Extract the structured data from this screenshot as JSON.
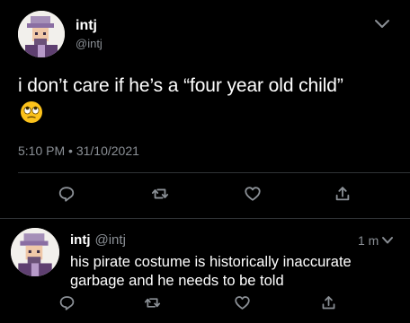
{
  "tweet": {
    "display_name": "intj",
    "handle": "@intj",
    "text": "i don’t care if he’s a “four year old child”",
    "emoji": "face-with-rolling-eyes",
    "timestamp": "5:10 PM • 31/10/2021"
  },
  "reply": {
    "display_name": "intj",
    "handle": "@intj",
    "time": "1 m",
    "text": "his pirate costume is historically inaccurate garbage and he needs to be told"
  },
  "icons": {
    "menu": "chevron-down-icon",
    "reply": "reply-icon",
    "retweet": "retweet-icon",
    "like": "heart-icon",
    "share": "share-icon"
  },
  "colors": {
    "background": "#000000",
    "text": "#ffffff",
    "secondary_text": "#8b9096",
    "divider": "#2f3336"
  }
}
